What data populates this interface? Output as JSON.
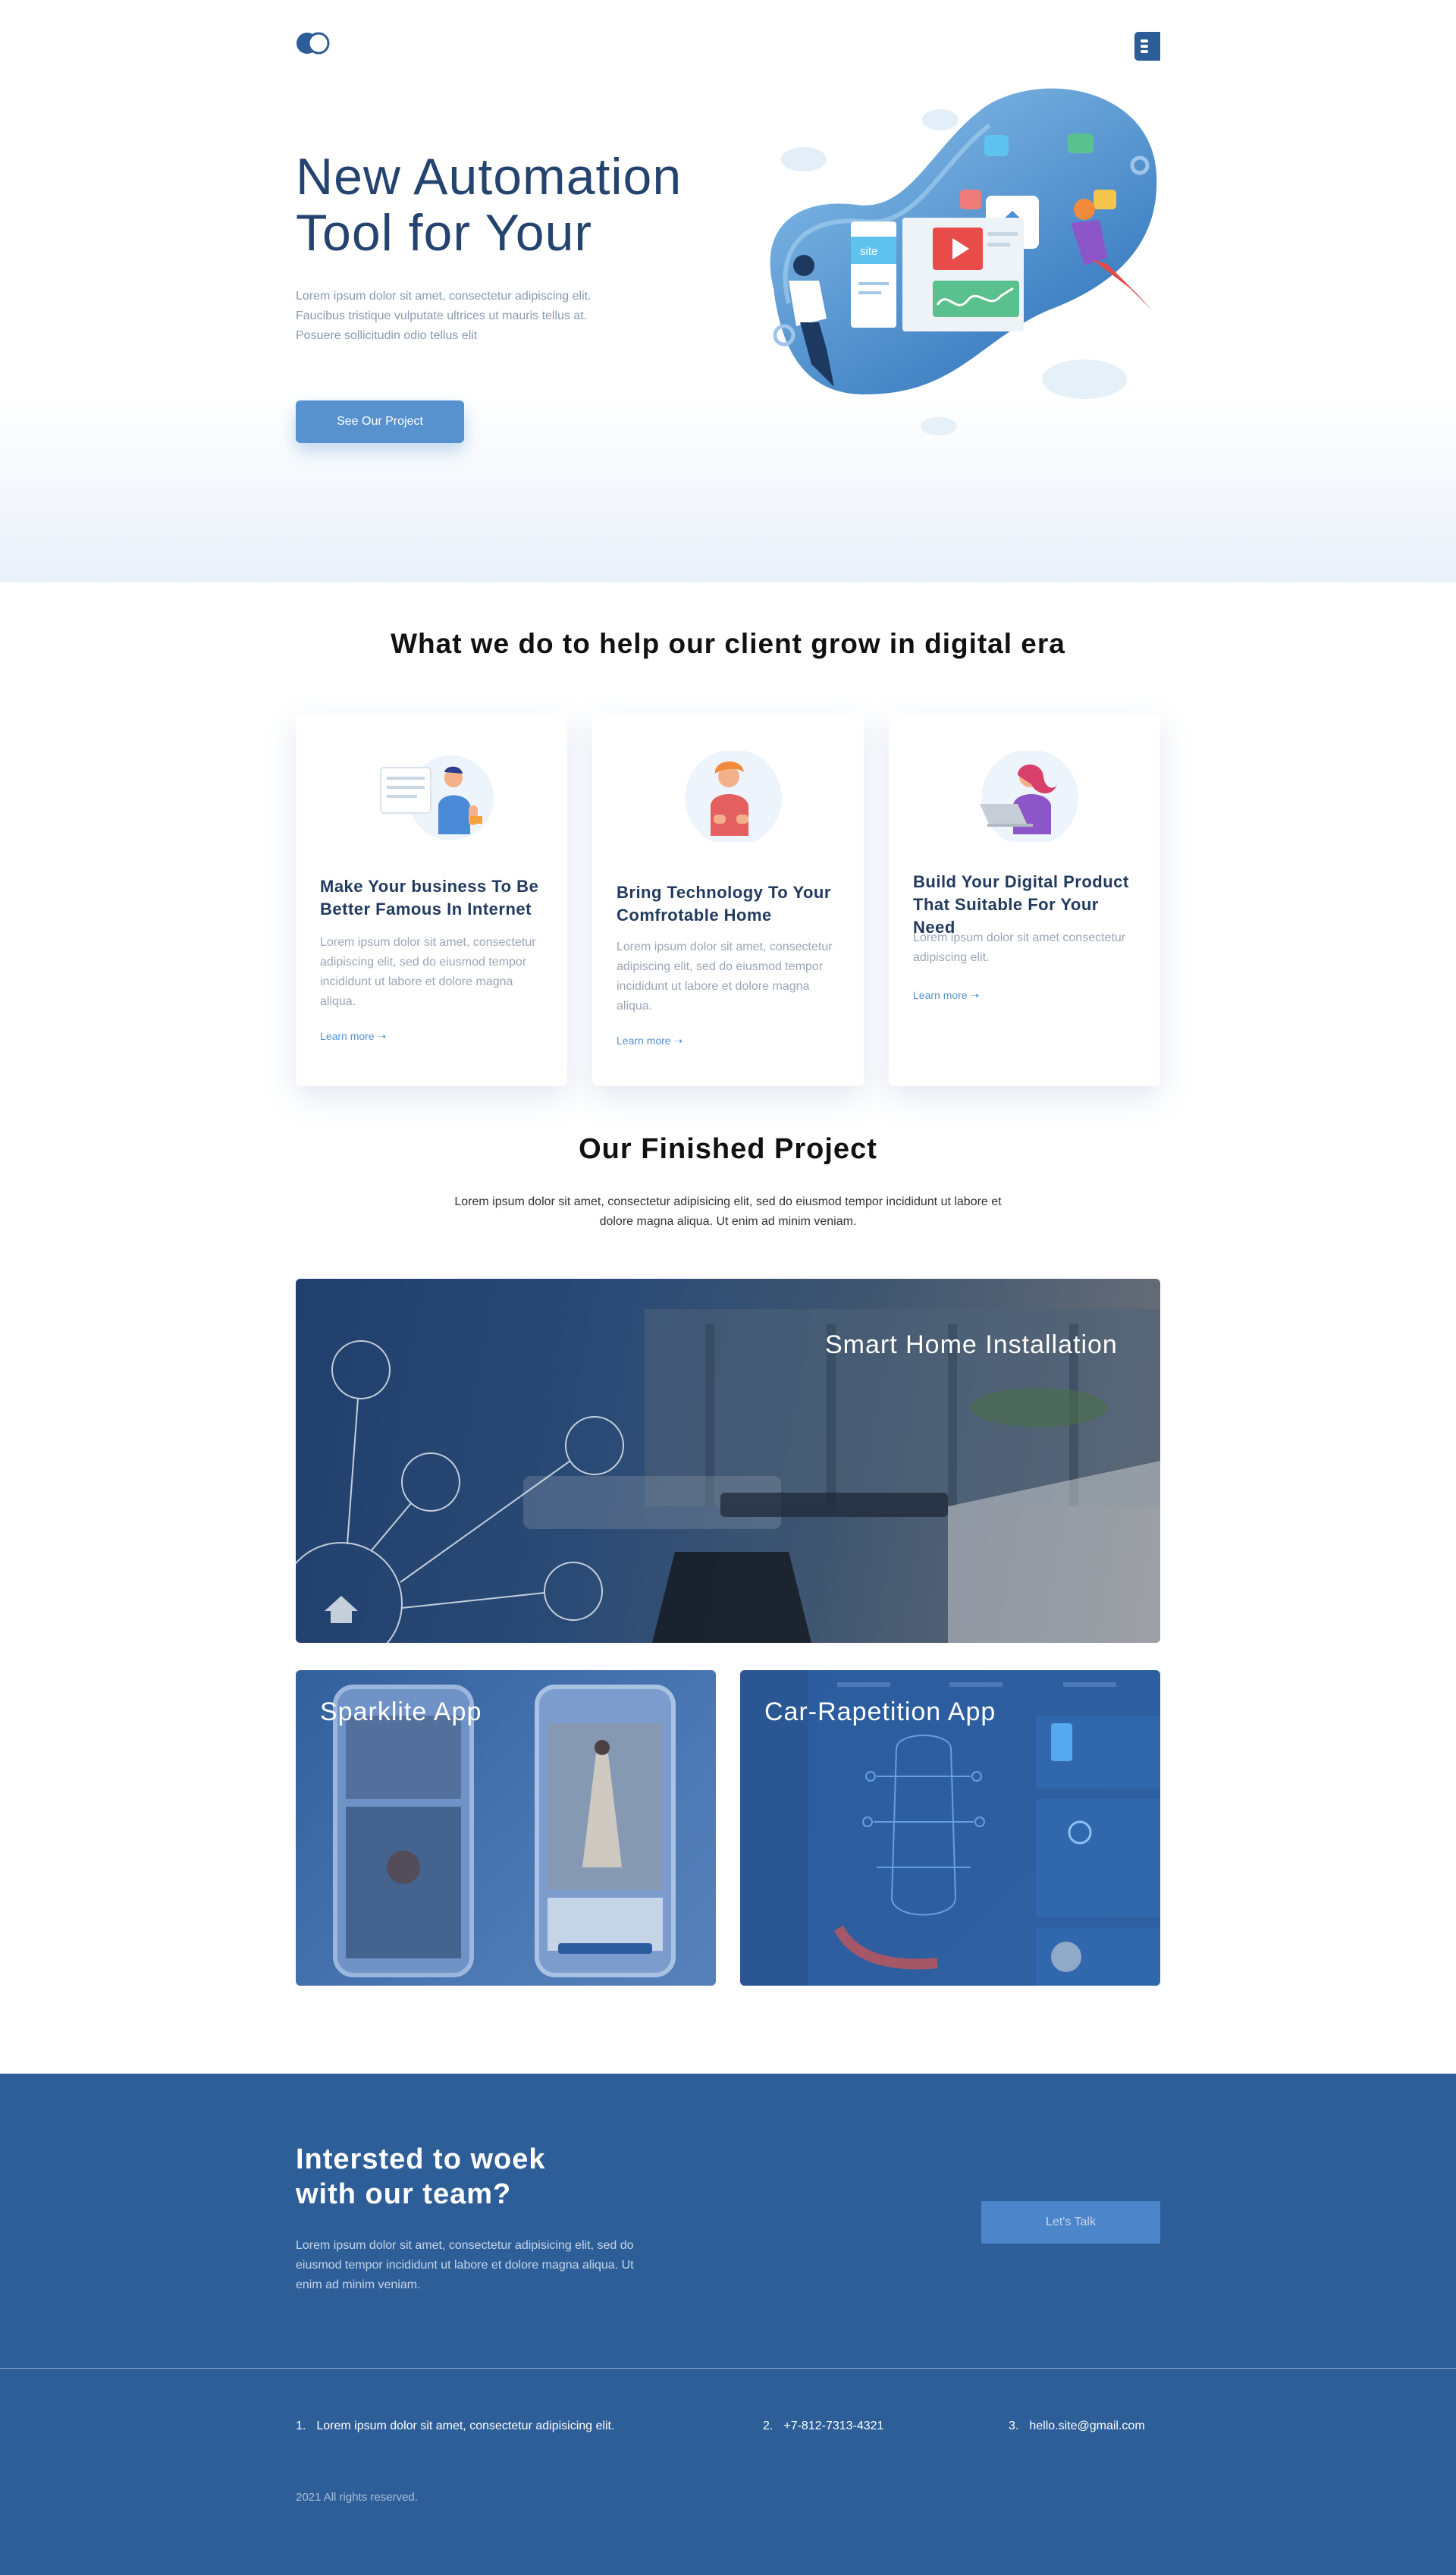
{
  "header": {
    "logo": "toggle-logo",
    "menu_icon": "menu-icon"
  },
  "hero": {
    "title_line1": "New Automation",
    "title_line2": "Tool for Your",
    "description": "Lorem ipsum dolor sit amet, consectetur adipiscing elit. Faucibus tristique vulputate ultrices ut mauris tellus at. Posuere sollicitudin odio tellus elit",
    "cta_label": "See Our Project",
    "illustration": {
      "browser_tag": "site"
    }
  },
  "services": {
    "title": "What we do to help our client grow in digital era",
    "cards": [
      {
        "title": "Make Your business To Be Better Famous In Internet",
        "description": "Lorem ipsum dolor sit amet, consectetur adipiscing elit, sed do eiusmod tempor incididunt ut labore et dolore magna aliqua.",
        "link": "Learn more ➝"
      },
      {
        "title": "Bring Technology To Your Comfrotable Home",
        "description": "Lorem ipsum dolor sit amet, consectetur adipiscing elit, sed do eiusmod tempor incididunt ut labore et dolore magna aliqua.",
        "link": "Learn more ➝"
      },
      {
        "title": "Build Your Digital Product That Suitable For Your Need",
        "description": "Lorem ipsum dolor sit amet consectetur adipiscing elit.",
        "link": "Learn more ➝"
      }
    ]
  },
  "projects": {
    "title": "Our Finished Project",
    "description": "Lorem ipsum dolor sit amet, consectetur adipisicing elit, sed do eiusmod tempor incididunt ut labore et dolore magna aliqua. Ut enim ad minim veniam.",
    "items": [
      {
        "label": "Smart Home Installation"
      },
      {
        "label": "Sparklite App"
      },
      {
        "label": "Car-Rapetition App"
      }
    ]
  },
  "cta": {
    "title_line1": "Intersted to woek",
    "title_line2": "with our team?",
    "description": "Lorem ipsum dolor sit amet, consectetur adipisicing elit, sed do eiusmod tempor incididunt ut labore et dolore magna aliqua. Ut enim ad minim veniam.",
    "button_label": "Let's Talk"
  },
  "footer": {
    "contacts": [
      {
        "num": "1.",
        "text": "Lorem ipsum dolor sit amet, consectetur adipisicing elit."
      },
      {
        "num": "2.",
        "text": "+7-812-7313-4321"
      },
      {
        "num": "3.",
        "text": "hello.site@gmail.com"
      }
    ],
    "copyright": "2021 All rights reserved."
  },
  "colors": {
    "primary": "#2e5e98",
    "accent": "#5792cf",
    "title": "#24446f",
    "muted": "#8a99ad"
  }
}
